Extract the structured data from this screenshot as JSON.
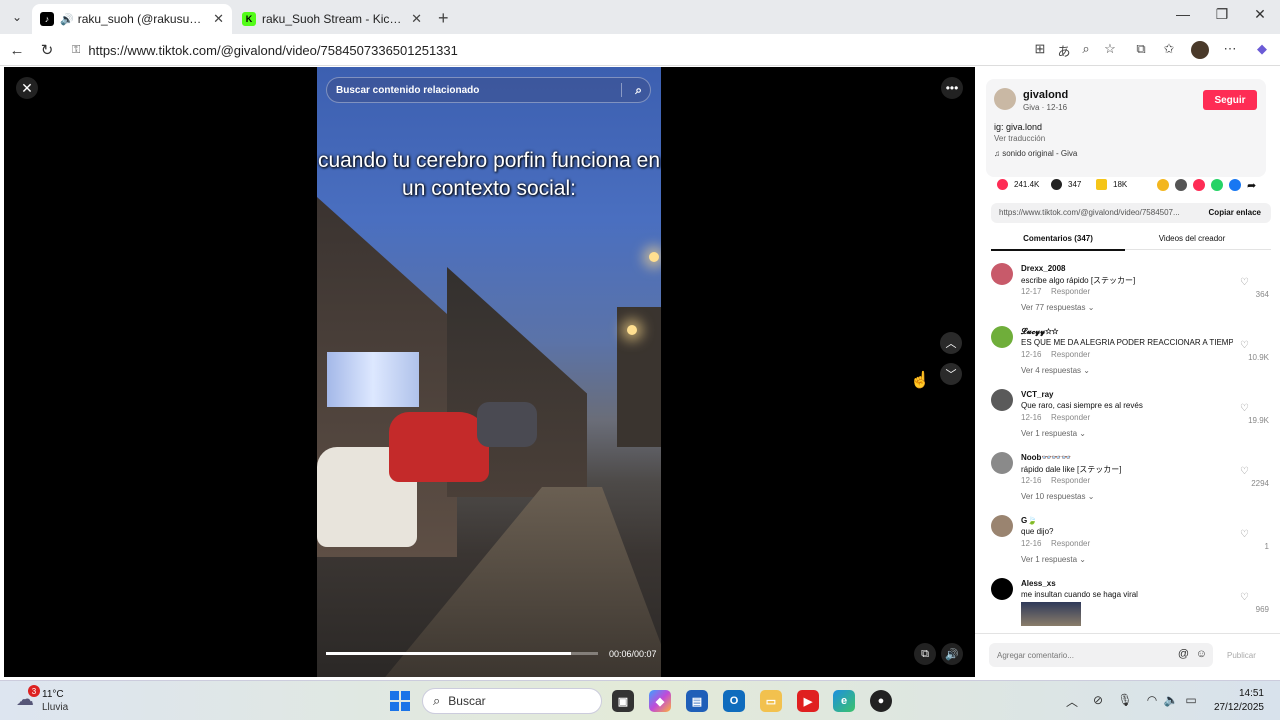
{
  "browser": {
    "tabs": [
      {
        "title": "raku_suoh (@rakusuohh) | TikTok",
        "active": true
      },
      {
        "title": "raku_Suoh Stream - Kick Dashboard",
        "active": false
      }
    ],
    "url": "https://www.tiktok.com/@givalond/video/7584507336501251331"
  },
  "video": {
    "search_placeholder": "Buscar contenido relacionado",
    "caption": "cuando tu cerebro porfin funciona en un contexto social:",
    "time": "00:06/00:07",
    "progress_fraction": 0.9
  },
  "creator": {
    "username": "givalond",
    "subtitle": "Giva · 12-16",
    "follow_label": "Seguir",
    "description": "ig: giva.lond",
    "translate": "Ver traducción",
    "sound": "sonido original - Giva"
  },
  "stats": {
    "likes": "241.4K",
    "comments": "347",
    "saves": "18K"
  },
  "link": {
    "url": "https://www.tiktok.com/@givalond/video/7584507...",
    "copy_label": "Copiar enlace"
  },
  "panel_tabs": [
    "Comentarios (347)",
    "Videos del creador"
  ],
  "comments": [
    {
      "user": "Drexx_2008",
      "text": "escribe algo rápido [ステッカー]",
      "date": "12-17",
      "reply": "Responder",
      "likes": "364",
      "more": "Ver 77 respuestas ⌄",
      "avatar_color": "#c85a6a"
    },
    {
      "user": "𝓛𝓾𝓬𝔂𝔂☆☆",
      "text": "ES QUE ME DA ALEGRIA PODER REACCIONAR A TIEMPO 😵",
      "date": "12-16",
      "reply": "Responder",
      "likes": "10.9K",
      "more": "Ver 4 respuestas ⌄",
      "avatar_color": "#6fae3a"
    },
    {
      "user": "VCT_ray",
      "text": "Que raro, casi siempre es al revés",
      "date": "12-16",
      "reply": "Responder",
      "likes": "19.9K",
      "more": "Ver 1 respuesta ⌄",
      "avatar_color": "#5a5a5a"
    },
    {
      "user": "Noob👓👓👓",
      "text": "rápido dale like [ステッカー]",
      "date": "12-16",
      "reply": "Responder",
      "likes": "2294",
      "more": "Ver 10 respuestas ⌄",
      "avatar_color": "#8a8a8a"
    },
    {
      "user": "G🍃",
      "text": "que dijo?",
      "date": "12-16",
      "reply": "Responder",
      "likes": "1",
      "more": "Ver 1 respuesta ⌄",
      "avatar_color": "#9a8470"
    },
    {
      "user": "Aless_xs",
      "text": "me insultan cuando se haga viral",
      "date": "",
      "reply": "",
      "likes": "969",
      "more": "",
      "avatar_color": "#000000"
    }
  ],
  "add_comment": {
    "placeholder": "Agregar comentario...",
    "publish": "Publicar"
  },
  "taskbar": {
    "weather_temp": "11°C",
    "weather_cond": "Lluvia",
    "weather_badge": "3",
    "search": "Buscar",
    "time": "14:51",
    "date": "27/12/2025"
  },
  "colors": {
    "follow": "#fe2c55",
    "like": "#fe2c55"
  }
}
